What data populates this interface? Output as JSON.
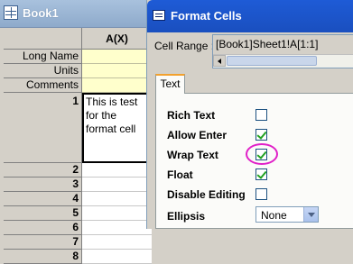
{
  "book": {
    "title": "Book1",
    "column_header": "A(X)",
    "header_rows": [
      "Long Name",
      "Units",
      "Comments"
    ],
    "row_numbers": [
      "1",
      "2",
      "3",
      "4",
      "5",
      "6",
      "7",
      "8"
    ],
    "cell_a1_text": "This is test for the format cell"
  },
  "dialog": {
    "title": "Format Cells",
    "cell_range_label": "Cell Range :",
    "cell_range_value": "[Book1]Sheet1!A[1:1]",
    "tab_label": "Text",
    "options": [
      {
        "label": "Rich Text",
        "checked": false
      },
      {
        "label": "Allow Enter",
        "checked": true
      },
      {
        "label": "Wrap Text",
        "checked": true
      },
      {
        "label": "Float",
        "checked": true
      },
      {
        "label": "Disable Editing",
        "checked": false
      }
    ],
    "ellipsis_label": "Ellipsis",
    "ellipsis_value": "None"
  },
  "colors": {
    "header_cell_fill": "#ffffcc",
    "dialog_title_bar": "#1e5bd6",
    "highlight_ring": "#e020c8",
    "checkmark": "#21a121"
  }
}
